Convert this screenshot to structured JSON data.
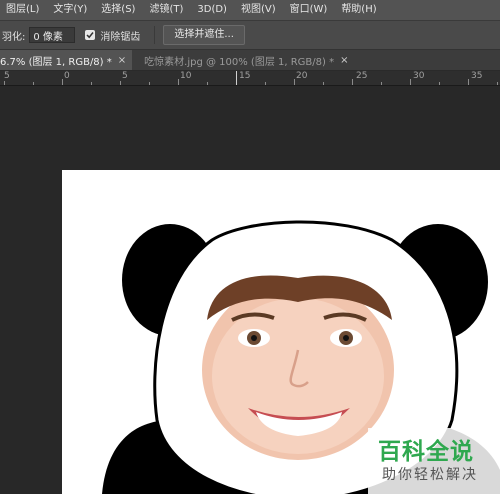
{
  "menubar": {
    "items": [
      "图层(L)",
      "文字(Y)",
      "选择(S)",
      "滤镜(T)",
      "3D(D)",
      "视图(V)",
      "窗口(W)",
      "帮助(H)"
    ]
  },
  "options": {
    "feather_label": "羽化:",
    "feather_value": "0 像素",
    "antialias_label": "消除锯齿",
    "antialias_checked": true,
    "select_mask_label": "选择并遮住..."
  },
  "tabs": [
    {
      "label": "6.7% (图层 1, RGB/8) *",
      "close": "×",
      "active": true
    },
    {
      "label": "吃惊素材.jpg @ 100% (图层 1, RGB/8) *",
      "close": "×",
      "active": false
    }
  ],
  "ruler": {
    "labels": [
      "5",
      "0",
      "5",
      "10",
      "15",
      "20",
      "25",
      "30",
      "35"
    ]
  },
  "watermark": {
    "logo": "百科全说",
    "subtitle": "助你轻松解决"
  },
  "colors": {
    "logo_green": "#2fa84f"
  }
}
